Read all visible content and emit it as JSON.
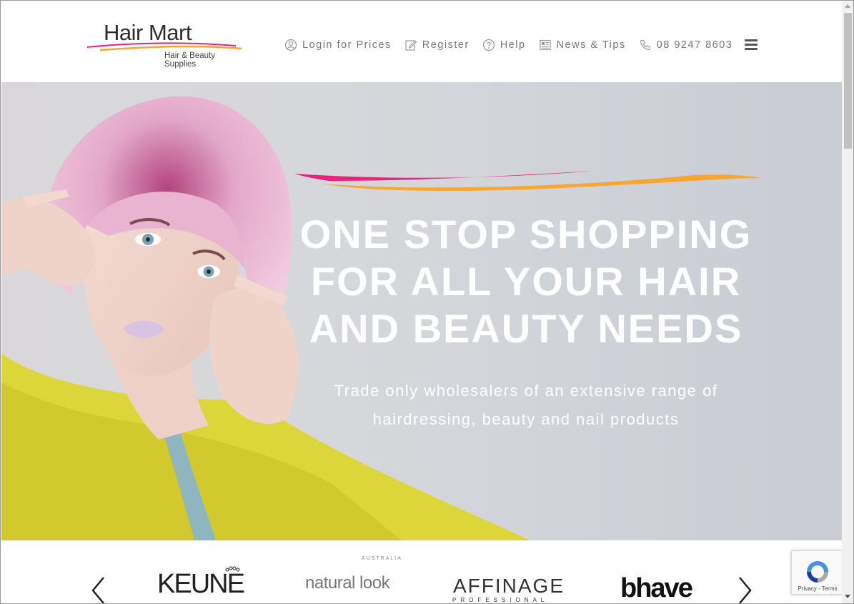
{
  "brand": {
    "name": "Hair Mart",
    "tagline": "Hair & Beauty Supplies",
    "colors": {
      "pink": "#e8237d",
      "orange": "#f7a631"
    }
  },
  "nav": {
    "items": [
      {
        "label": "Login for Prices",
        "icon": "user-circle-icon"
      },
      {
        "label": "Register",
        "icon": "edit-icon"
      },
      {
        "label": "Help",
        "icon": "question-icon"
      },
      {
        "label": "News & Tips",
        "icon": "newspaper-icon"
      },
      {
        "label": "08 9247 8603",
        "icon": "phone-icon"
      }
    ],
    "menu_icon": "hamburger-icon"
  },
  "hero": {
    "title_line1": "ONE STOP SHOPPING",
    "title_line2": "FOR ALL YOUR HAIR",
    "title_line3": "AND BEAUTY NEEDS",
    "subtitle_line1": "Trade only wholesalers of an extensive range of",
    "subtitle_line2": "hairdressing, beauty and nail products"
  },
  "brands": {
    "items": [
      "KEUNE",
      "natural look",
      "AFFINAGE",
      "bhave"
    ],
    "natural_look_sub": "AUSTRALIA",
    "affinage_sub": "PROFESSIONAL",
    "prev_icon": "chevron-left-icon",
    "next_icon": "chevron-right-icon"
  },
  "recaptcha": {
    "privacy": "Privacy",
    "separator": " - ",
    "terms": "Terms"
  }
}
